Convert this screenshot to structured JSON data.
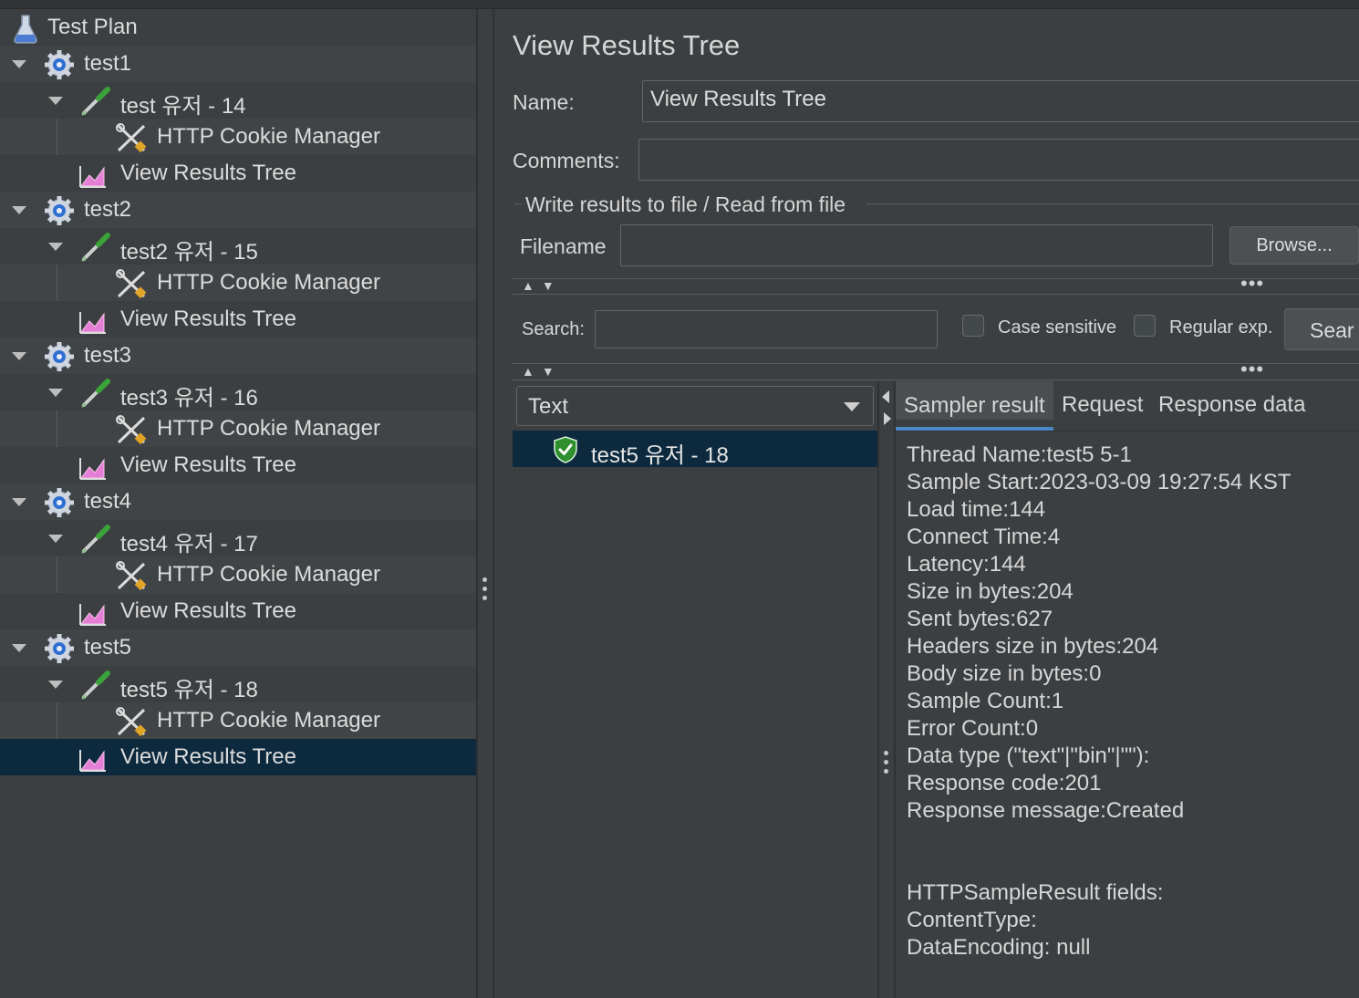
{
  "tree": {
    "root": "Test Plan",
    "groups": [
      {
        "name": "test1",
        "thread": "test 유저 - 14",
        "cookie": "HTTP Cookie Manager",
        "listener": "View Results Tree"
      },
      {
        "name": "test2",
        "thread": "test2 유저 - 15",
        "cookie": "HTTP Cookie Manager",
        "listener": "View Results Tree"
      },
      {
        "name": "test3",
        "thread": "test3 유저 - 16",
        "cookie": "HTTP Cookie Manager",
        "listener": "View Results Tree"
      },
      {
        "name": "test4",
        "thread": "test4 유저 - 17",
        "cookie": "HTTP Cookie Manager",
        "listener": "View Results Tree"
      },
      {
        "name": "test5",
        "thread": "test5 유저 - 18",
        "cookie": "HTTP Cookie Manager",
        "listener": "View Results Tree"
      }
    ]
  },
  "panel": {
    "title": "View Results Tree",
    "name_label": "Name:",
    "name_value": "View Results Tree",
    "comments_label": "Comments:",
    "comments_value": "",
    "file_section": "Write results to file / Read from file",
    "filename_label": "Filename",
    "filename_value": "",
    "browse_label": "Browse...",
    "search_label": "Search:",
    "search_value": "",
    "case_sensitive_label": "Case sensitive",
    "regex_label": "Regular exp.",
    "search_button": "Sear"
  },
  "results": {
    "renderer": "Text",
    "samples": [
      {
        "label": "test5 유저 - 18",
        "status": "success"
      }
    ],
    "tabs": [
      "Sampler result",
      "Request",
      "Response data"
    ],
    "active_tab": "Sampler result",
    "sampler_lines": [
      "Thread Name:test5 5-1",
      "Sample Start:2023-03-09 19:27:54 KST",
      "Load time:144",
      "Connect Time:4",
      "Latency:144",
      "Size in bytes:204",
      "Sent bytes:627",
      "Headers size in bytes:204",
      "Body size in bytes:0",
      "Sample Count:1",
      "Error Count:0",
      "Data type (\"text\"|\"bin\"|\"\"):",
      "Response code:201",
      "Response message:Created",
      "",
      "",
      "HTTPSampleResult fields:",
      "ContentType:",
      "DataEncoding: null"
    ]
  },
  "colors": {
    "selection": "#0d293e",
    "tab_underline": "#4a88c7",
    "success": "#3aa33a"
  }
}
